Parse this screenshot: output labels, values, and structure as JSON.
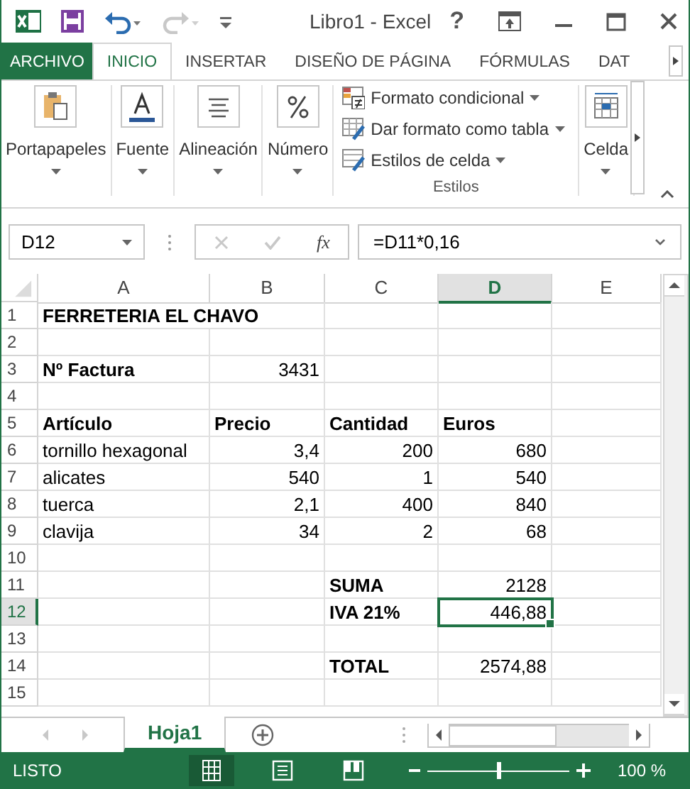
{
  "window": {
    "title": "Libro1 - Excel"
  },
  "quick_access": [
    {
      "kind": "save",
      "disabled": false
    },
    {
      "kind": "undo",
      "disabled": false
    },
    {
      "kind": "redo",
      "disabled": true
    },
    {
      "kind": "customize",
      "disabled": false
    }
  ],
  "window_controls": [
    {
      "kind": "help",
      "symbol": "?"
    },
    {
      "kind": "ribbon-options"
    },
    {
      "kind": "minimize"
    },
    {
      "kind": "maximize"
    },
    {
      "kind": "close"
    }
  ],
  "ribbon_tabs": [
    {
      "label": "ARCHIVO",
      "kind": "file",
      "selected": false
    },
    {
      "label": "INICIO",
      "kind": "tab",
      "selected": true
    },
    {
      "label": "INSERTAR",
      "kind": "tab",
      "selected": false
    },
    {
      "label": "DISEÑO DE PÁGINA",
      "kind": "tab",
      "selected": false
    },
    {
      "label": "FÓRMULAS",
      "kind": "tab",
      "selected": false
    },
    {
      "label": "DAT",
      "kind": "tab",
      "selected": false
    }
  ],
  "ribbon_groups": [
    {
      "kind": "large",
      "label": "Portapapeles"
    },
    {
      "kind": "large",
      "label": "Fuente"
    },
    {
      "kind": "large",
      "label": "Alineación"
    },
    {
      "kind": "large",
      "label": "Número"
    },
    {
      "kind": "styles",
      "label": "Estilos",
      "items": [
        {
          "label": "Formato condicional"
        },
        {
          "label": "Dar formato como tabla"
        },
        {
          "label": "Estilos de celda"
        }
      ]
    },
    {
      "kind": "large",
      "label": "Celda"
    }
  ],
  "formula_bar": {
    "name_box": "D12",
    "function_symbol": "fx",
    "formula": "=D11*0,16"
  },
  "sheet": {
    "columns": [
      {
        "label": "A",
        "selected": false
      },
      {
        "label": "B",
        "selected": false
      },
      {
        "label": "C",
        "selected": false
      },
      {
        "label": "D",
        "selected": true
      },
      {
        "label": "E",
        "selected": false
      }
    ],
    "rows": [
      {
        "header": "1",
        "selected": false,
        "cells": [
          {
            "text": "FERRETERIA EL CHAVO",
            "kind": "text",
            "bold": true,
            "selected": false
          },
          {
            "selected": false
          },
          {
            "selected": false
          },
          {
            "selected": false
          },
          {
            "selected": false
          }
        ]
      },
      {
        "header": "2",
        "selected": false,
        "cells": [
          {
            "selected": false
          },
          {
            "selected": false
          },
          {
            "selected": false
          },
          {
            "selected": false
          },
          {
            "selected": false
          }
        ]
      },
      {
        "header": "3",
        "selected": false,
        "cells": [
          {
            "text": "Nº Factura",
            "kind": "text",
            "bold": true,
            "selected": false
          },
          {
            "text": "3431",
            "kind": "number",
            "bold": false,
            "selected": false
          },
          {
            "selected": false
          },
          {
            "selected": false
          },
          {
            "selected": false
          }
        ]
      },
      {
        "header": "4",
        "selected": false,
        "cells": [
          {
            "selected": false
          },
          {
            "selected": false
          },
          {
            "selected": false
          },
          {
            "selected": false
          },
          {
            "selected": false
          }
        ]
      },
      {
        "header": "5",
        "selected": false,
        "cells": [
          {
            "text": "Artículo",
            "kind": "text",
            "bold": true,
            "selected": false
          },
          {
            "text": "Precio",
            "kind": "text",
            "bold": true,
            "selected": false
          },
          {
            "text": "Cantidad",
            "kind": "text",
            "bold": true,
            "selected": false
          },
          {
            "text": "Euros",
            "kind": "text",
            "bold": true,
            "selected": false
          },
          {
            "selected": false
          }
        ]
      },
      {
        "header": "6",
        "selected": false,
        "cells": [
          {
            "text": "tornillo hexagonal",
            "kind": "text",
            "bold": false,
            "selected": false
          },
          {
            "text": "3,4",
            "kind": "number",
            "bold": false,
            "selected": false
          },
          {
            "text": "200",
            "kind": "number",
            "bold": false,
            "selected": false
          },
          {
            "text": "680",
            "kind": "number",
            "bold": false,
            "selected": false
          },
          {
            "selected": false
          }
        ]
      },
      {
        "header": "7",
        "selected": false,
        "cells": [
          {
            "text": "alicates",
            "kind": "text",
            "bold": false,
            "selected": false
          },
          {
            "text": "540",
            "kind": "number",
            "bold": false,
            "selected": false
          },
          {
            "text": "1",
            "kind": "number",
            "bold": false,
            "selected": false
          },
          {
            "text": "540",
            "kind": "number",
            "bold": false,
            "selected": false
          },
          {
            "selected": false
          }
        ]
      },
      {
        "header": "8",
        "selected": false,
        "cells": [
          {
            "text": "tuerca",
            "kind": "text",
            "bold": false,
            "selected": false
          },
          {
            "text": "2,1",
            "kind": "number",
            "bold": false,
            "selected": false
          },
          {
            "text": "400",
            "kind": "number",
            "bold": false,
            "selected": false
          },
          {
            "text": "840",
            "kind": "number",
            "bold": false,
            "selected": false
          },
          {
            "selected": false
          }
        ]
      },
      {
        "header": "9",
        "selected": false,
        "cells": [
          {
            "text": "clavija",
            "kind": "text",
            "bold": false,
            "selected": false
          },
          {
            "text": "34",
            "kind": "number",
            "bold": false,
            "selected": false
          },
          {
            "text": "2",
            "kind": "number",
            "bold": false,
            "selected": false
          },
          {
            "text": "68",
            "kind": "number",
            "bold": false,
            "selected": false
          },
          {
            "selected": false
          }
        ]
      },
      {
        "header": "10",
        "selected": false,
        "cells": [
          {
            "selected": false
          },
          {
            "selected": false
          },
          {
            "selected": false
          },
          {
            "selected": false
          },
          {
            "selected": false
          }
        ]
      },
      {
        "header": "11",
        "selected": false,
        "cells": [
          {
            "selected": false
          },
          {
            "selected": false
          },
          {
            "text": "SUMA",
            "kind": "text",
            "bold": true,
            "selected": false
          },
          {
            "text": "2128",
            "kind": "number",
            "bold": false,
            "selected": false
          },
          {
            "selected": false
          }
        ]
      },
      {
        "header": "12",
        "selected": true,
        "cells": [
          {
            "selected": false
          },
          {
            "selected": false
          },
          {
            "text": "IVA 21%",
            "kind": "text",
            "bold": true,
            "selected": false
          },
          {
            "text": "446,88",
            "kind": "number",
            "bold": false,
            "selected": true
          },
          {
            "selected": false
          }
        ]
      },
      {
        "header": "13",
        "selected": false,
        "cells": [
          {
            "selected": false
          },
          {
            "selected": false
          },
          {
            "selected": false
          },
          {
            "selected": false
          },
          {
            "selected": false
          }
        ]
      },
      {
        "header": "14",
        "selected": false,
        "cells": [
          {
            "selected": false
          },
          {
            "selected": false
          },
          {
            "text": "TOTAL",
            "kind": "text",
            "bold": true,
            "selected": false
          },
          {
            "text": "2574,88",
            "kind": "number",
            "bold": false,
            "selected": false
          },
          {
            "selected": false
          }
        ]
      },
      {
        "header": "15",
        "selected": false,
        "cells": [
          {
            "selected": false
          },
          {
            "selected": false
          },
          {
            "selected": false
          },
          {
            "selected": false
          },
          {
            "selected": false
          }
        ]
      }
    ]
  },
  "sheet_tabs": [
    {
      "label": "Hoja1",
      "selected": true
    }
  ],
  "status_bar": {
    "status": "LISTO",
    "views": [
      {
        "kind": "normal",
        "selected": true
      },
      {
        "kind": "page-layout",
        "selected": false
      },
      {
        "kind": "page-break",
        "selected": false
      }
    ],
    "zoom": {
      "level": 0.5,
      "reading": "100 %"
    }
  }
}
